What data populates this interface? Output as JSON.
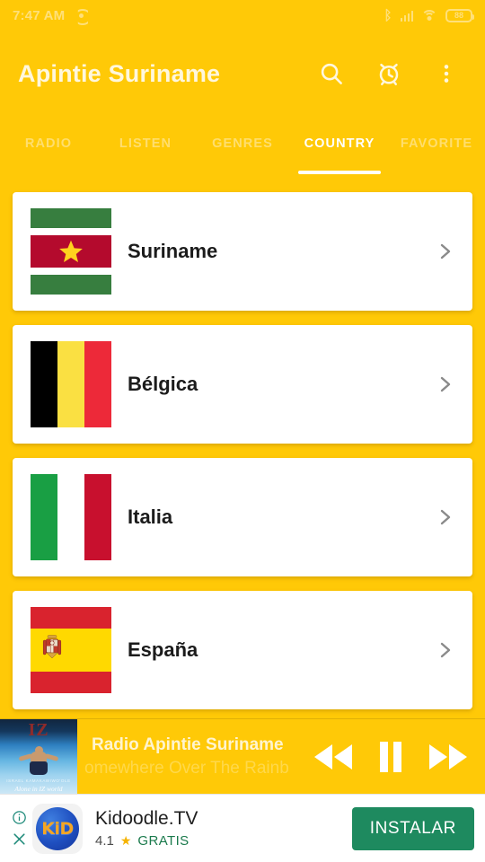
{
  "statusbar": {
    "clock": "7:47 AM",
    "broadcast_icon": "broadcast-icon",
    "bluetooth_glyph": "ᛒ",
    "battery_level": "88"
  },
  "appbar": {
    "title": "Apintie Suriname",
    "actions": [
      {
        "name": "search-icon",
        "label": "Search"
      },
      {
        "name": "alarm-icon",
        "label": "Sleep timer"
      },
      {
        "name": "overflow-menu-icon",
        "label": "More options"
      }
    ]
  },
  "tabs": {
    "items": [
      {
        "label": "RADIO",
        "active": false
      },
      {
        "label": "LISTEN",
        "active": false
      },
      {
        "label": "GENRES",
        "active": false
      },
      {
        "label": "COUNTRY",
        "active": true
      },
      {
        "label": "FAVORITE",
        "active": false
      }
    ]
  },
  "country_list": [
    {
      "name": "Suriname",
      "flag": "suriname"
    },
    {
      "name": "Bélgica",
      "flag": "belgica"
    },
    {
      "name": "Italia",
      "flag": "italia"
    },
    {
      "name": "España",
      "flag": "espana"
    }
  ],
  "player": {
    "album_art_title": "IZ",
    "album_art_artist": "ISRAEL KAMAKAWIWO'OLE",
    "album_art_caption": "Alone in IZ world",
    "station": "Radio Apintie Suriname",
    "now_playing": "omewhere Over The Rainb",
    "controls": [
      {
        "name": "rewind-button",
        "label": "Rewind"
      },
      {
        "name": "pause-button",
        "label": "Pause"
      },
      {
        "name": "forward-button",
        "label": "Forward"
      }
    ]
  },
  "ad": {
    "info_icon": "info-icon",
    "close_icon": "close-icon",
    "logo_text": "KiD",
    "app_name": "Kidoodle.TV",
    "rating": "4.1",
    "star_glyph": "★",
    "price": "GRATIS",
    "cta_label": "INSTALAR"
  },
  "colors": {
    "brand_yellow": "#FFC907",
    "title_cream": "#FFF7DD",
    "tab_inactive": "#FFDE6E",
    "tab_active": "#FFFFFF",
    "card_white": "#FFFFFF",
    "chevron_gray": "#8a8a8a",
    "ad_cta_green": "#1E8A5F",
    "ad_free_green": "#1a7a4c",
    "star_gold": "#F5B301"
  }
}
